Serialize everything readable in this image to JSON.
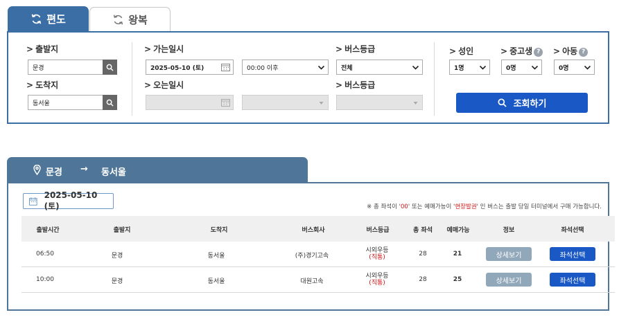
{
  "tabs": {
    "oneway": "편도",
    "roundtrip": "왕복"
  },
  "search": {
    "departure_label": "출발지",
    "departure_value": "문경",
    "arrival_label": "도착지",
    "arrival_value": "동서울",
    "go_date_label": "가는일시",
    "go_date_value": "2025-05-10 (토)",
    "go_time_value": "00:00 이후",
    "return_date_label": "오는일시",
    "bus_grade_label": "버스등급",
    "bus_grade_value": "전체",
    "bus_grade_label_2": "버스등급",
    "adult_label": "성인",
    "adult_value": "1명",
    "youth_label": "중고생",
    "youth_value": "0명",
    "child_label": "아동",
    "child_value": "0명",
    "help_mark": "?",
    "query_button": "조회하기",
    "arrow": ">"
  },
  "route": {
    "from": "문경",
    "arrow": "→",
    "to": "동서울"
  },
  "results": {
    "date": "2025-05-10 (토)",
    "notice_pre": "※ 총 좌석이 '",
    "notice_zero": "00",
    "notice_mid": "' 또는 예매가능이 '",
    "notice_onsite": "현장발권",
    "notice_post": "' 인 버스는 출발 당일 터미널에서 구매 가능합니다.",
    "columns": [
      "출발시간",
      "출발지",
      "도착지",
      "버스회사",
      "버스등급",
      "총 좌석",
      "예매가능",
      "정보",
      "좌석선택"
    ],
    "rows": [
      {
        "time": "06:50",
        "from": "문경",
        "to": "동서울",
        "company": "(주)경기고속",
        "grade": "시외우등",
        "grade_sub": "(직통)",
        "total": "28",
        "available": "21",
        "detail": "상세보기",
        "select": "좌석선택"
      },
      {
        "time": "10:00",
        "from": "문경",
        "to": "동서울",
        "company": "대원고속",
        "grade": "시외우등",
        "grade_sub": "(직통)",
        "total": "28",
        "available": "25",
        "detail": "상세보기",
        "select": "좌석선택"
      }
    ]
  },
  "colors": {
    "tab_active": "#3a6ea5",
    "route_header": "#4f7699",
    "primary_button": "#1a58c6",
    "detail_button": "#91a7ba",
    "notice_red": "#d31212"
  }
}
